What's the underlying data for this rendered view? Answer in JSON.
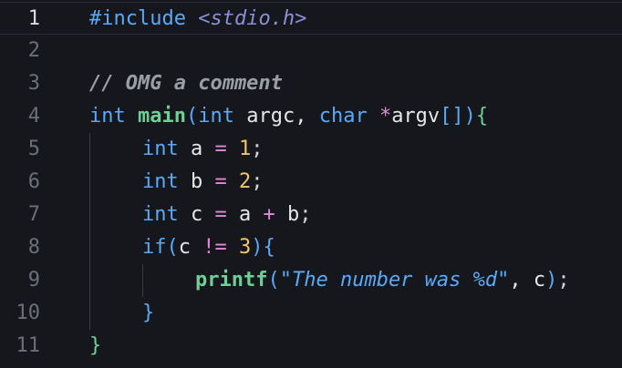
{
  "editor": {
    "active_line": 1,
    "lines": [
      {
        "number": "1"
      },
      {
        "number": "2"
      },
      {
        "number": "3"
      },
      {
        "number": "4"
      },
      {
        "number": "5"
      },
      {
        "number": "6"
      },
      {
        "number": "7"
      },
      {
        "number": "8"
      },
      {
        "number": "9"
      },
      {
        "number": "10"
      },
      {
        "number": "11"
      }
    ],
    "tokens": {
      "l1": {
        "directive": "#include",
        "header": "<stdio.h>"
      },
      "l3": {
        "comment": "// OMG a comment"
      },
      "l4": {
        "t_int": "int",
        "fn_main": "main",
        "paren_open": "(",
        "t_int2": "int",
        "argc": " argc, ",
        "t_char": "char",
        "star": "*",
        "argv": "argv",
        "brackets": "[]",
        "paren_close": ")",
        "brace_open": "{"
      },
      "l5": {
        "t_int": "int",
        "rest": " a ",
        "eq": "=",
        "num": "1",
        "semi": ";"
      },
      "l6": {
        "t_int": "int",
        "rest": " b ",
        "eq": "=",
        "num": "2",
        "semi": ";"
      },
      "l7": {
        "t_int": "int",
        "rest": " c ",
        "eq": "=",
        "a": " a ",
        "plus": "+",
        "b": " b",
        "semi": ";"
      },
      "l8": {
        "kw_if": "if",
        "paren_open": "(",
        "c": "c ",
        "neq": "!=",
        "num": " 3",
        "paren_close": ")",
        "brace_open": "{"
      },
      "l9": {
        "fn": "printf",
        "paren_open": "(",
        "str": "\"The number was %d\"",
        "rest": ", c",
        "paren_close": ")",
        "semi": ";"
      },
      "l10": {
        "brace_close": "}"
      },
      "l11": {
        "brace_close": "}"
      }
    }
  }
}
